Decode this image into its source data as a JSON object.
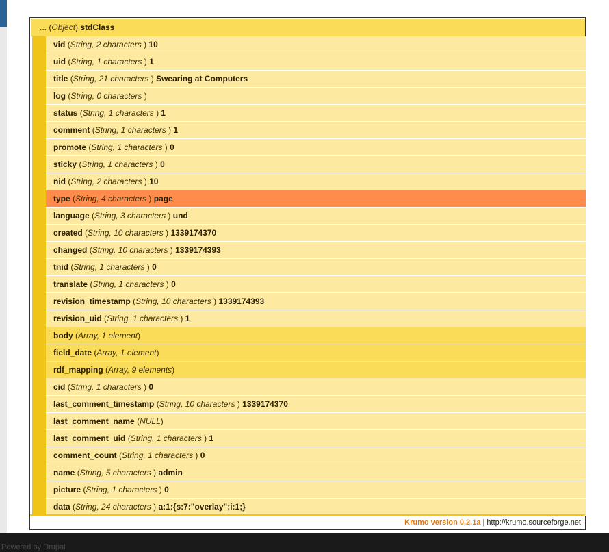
{
  "background": {
    "footer_text": "Powered by Drupal"
  },
  "krumo": {
    "root": {
      "prefix": "...",
      "type": "Object",
      "class": "stdClass"
    },
    "rows": [
      {
        "key": "vid",
        "meta": "String, 2 characters ",
        "value": "10",
        "kind": "scalar"
      },
      {
        "key": "uid",
        "meta": "String, 1 characters ",
        "value": "1",
        "kind": "scalar"
      },
      {
        "key": "title",
        "meta": "String, 21 characters ",
        "value": "Swearing at Computers",
        "kind": "scalar"
      },
      {
        "key": "log",
        "meta": "String, 0 characters ",
        "value": "",
        "kind": "scalar"
      },
      {
        "key": "status",
        "meta": "String, 1 characters ",
        "value": "1",
        "kind": "scalar"
      },
      {
        "key": "comment",
        "meta": "String, 1 characters ",
        "value": "1",
        "kind": "scalar"
      },
      {
        "key": "promote",
        "meta": "String, 1 characters ",
        "value": "0",
        "kind": "scalar"
      },
      {
        "key": "sticky",
        "meta": "String, 1 characters ",
        "value": "0",
        "kind": "scalar"
      },
      {
        "key": "nid",
        "meta": "String, 2 characters ",
        "value": "10",
        "kind": "scalar"
      },
      {
        "key": "type",
        "meta": "String, 4 characters ",
        "value": "page",
        "kind": "scalar",
        "highlighted": true
      },
      {
        "key": "language",
        "meta": "String, 3 characters ",
        "value": "und",
        "kind": "scalar"
      },
      {
        "key": "created",
        "meta": "String, 10 characters ",
        "value": "1339174370",
        "kind": "scalar"
      },
      {
        "key": "changed",
        "meta": "String, 10 characters ",
        "value": "1339174393",
        "kind": "scalar"
      },
      {
        "key": "tnid",
        "meta": "String, 1 characters ",
        "value": "0",
        "kind": "scalar"
      },
      {
        "key": "translate",
        "meta": "String, 1 characters ",
        "value": "0",
        "kind": "scalar"
      },
      {
        "key": "revision_timestamp",
        "meta": "String, 10 characters ",
        "value": "1339174393",
        "kind": "scalar"
      },
      {
        "key": "revision_uid",
        "meta": "String, 1 characters ",
        "value": "1",
        "kind": "scalar"
      },
      {
        "key": "body",
        "meta": "Array, 1 element",
        "value": "",
        "kind": "collapsible"
      },
      {
        "key": "field_date",
        "meta": "Array, 1 element",
        "value": "",
        "kind": "collapsible"
      },
      {
        "key": "rdf_mapping",
        "meta": "Array, 9 elements",
        "value": "",
        "kind": "collapsible"
      },
      {
        "key": "cid",
        "meta": "String, 1 characters ",
        "value": "0",
        "kind": "scalar"
      },
      {
        "key": "last_comment_timestamp",
        "meta": "String, 10 characters ",
        "value": "1339174370",
        "kind": "scalar"
      },
      {
        "key": "last_comment_name",
        "meta": "NULL",
        "value": "",
        "kind": "scalar"
      },
      {
        "key": "last_comment_uid",
        "meta": "String, 1 characters ",
        "value": "1",
        "kind": "scalar"
      },
      {
        "key": "comment_count",
        "meta": "String, 1 characters ",
        "value": "0",
        "kind": "scalar"
      },
      {
        "key": "name",
        "meta": "String, 5 characters ",
        "value": "admin",
        "kind": "scalar"
      },
      {
        "key": "picture",
        "meta": "String, 1 characters ",
        "value": "0",
        "kind": "scalar"
      },
      {
        "key": "data",
        "meta": "String, 24 characters ",
        "value": "a:1:{s:7:\"overlay\";i:1;}",
        "kind": "scalar"
      }
    ],
    "footer": {
      "version_label": "Krumo version 0.2.1a",
      "separator": "|",
      "link_text": "http://krumo.sourceforge.net"
    }
  }
}
